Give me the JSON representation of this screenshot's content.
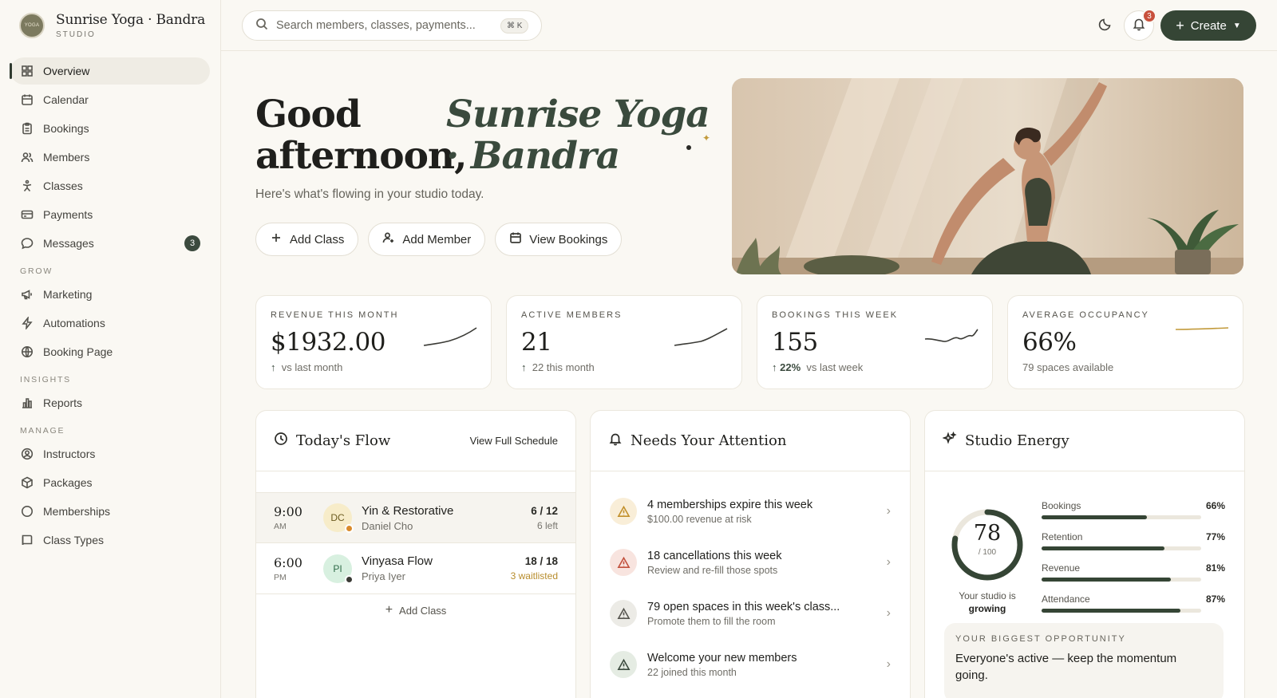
{
  "brand": {
    "name": "Sunrise Yoga · Bandra",
    "sub": "STUDIO",
    "logo_text": "YOGA"
  },
  "sidebar": {
    "items": [
      {
        "label": "Overview",
        "icon": "grid-icon"
      },
      {
        "label": "Calendar",
        "icon": "calendar-icon"
      },
      {
        "label": "Bookings",
        "icon": "clipboard-icon"
      },
      {
        "label": "Members",
        "icon": "users-icon"
      },
      {
        "label": "Classes",
        "icon": "yoga-pose-icon"
      },
      {
        "label": "Payments",
        "icon": "card-icon"
      },
      {
        "label": "Messages",
        "icon": "chat-icon",
        "badge": "3"
      }
    ],
    "grow_label": "GROW",
    "grow": [
      {
        "label": "Marketing",
        "icon": "megaphone-icon"
      },
      {
        "label": "Automations",
        "icon": "bolt-icon"
      },
      {
        "label": "Booking Page",
        "icon": "globe-icon"
      }
    ],
    "insights_label": "INSIGHTS",
    "insights": [
      {
        "label": "Reports",
        "icon": "bar-chart-icon"
      }
    ],
    "manage_label": "MANAGE",
    "manage": [
      {
        "label": "Instructors",
        "icon": "user-circle-icon"
      },
      {
        "label": "Packages",
        "icon": "package-icon"
      },
      {
        "label": "Memberships",
        "icon": "circle-icon"
      },
      {
        "label": "Class Types",
        "icon": "book-icon"
      }
    ]
  },
  "topbar": {
    "search_placeholder": "Search members, classes, payments...",
    "search_kbd": "⌘ K",
    "notifications_count": "3",
    "create_label": "Create"
  },
  "hero": {
    "greeting_line1": "Good",
    "greeting_line2": "afternoon,",
    "studio_line1": "Sunrise Yoga",
    "studio_line2": "· Bandra",
    "subtitle": "Here's what's flowing in your studio today.",
    "actions": [
      "Add Class",
      "Add Member",
      "View Bookings"
    ]
  },
  "stats": [
    {
      "label": "REVENUE THIS MONTH",
      "value": "$1932.00",
      "arrow": "↑",
      "pct": "",
      "sub": "vs last month"
    },
    {
      "label": "ACTIVE MEMBERS",
      "value": "21",
      "arrow": "↑",
      "pct": "",
      "sub": "22 this month"
    },
    {
      "label": "BOOKINGS THIS WEEK",
      "value": "155",
      "arrow": "↑",
      "pct": "22%",
      "sub": "vs last week"
    },
    {
      "label": "AVERAGE OCCUPANCY",
      "value": "66%",
      "arrow": "",
      "pct": "",
      "sub": "79 spaces available"
    }
  ],
  "todays_flow": {
    "title": "Today's Flow",
    "link": "View Full Schedule",
    "classes": [
      {
        "time": "9:00",
        "ampm": "AM",
        "initials": "DC",
        "name": "Yin & Restorative",
        "instructor": "Daniel Cho",
        "capacity": "6 / 12",
        "status": "6 left"
      },
      {
        "time": "6:00",
        "ampm": "PM",
        "initials": "PI",
        "name": "Vinyasa Flow",
        "instructor": "Priya Iyer",
        "capacity": "18 / 18",
        "status": "3 waitlisted"
      }
    ],
    "add_label": "Add Class"
  },
  "attention": {
    "title": "Needs Your Attention",
    "items": [
      {
        "title": "4 memberships expire this week",
        "sub": "$100.00 revenue at risk"
      },
      {
        "title": "18 cancellations this week",
        "sub": "Review and re-fill those spots"
      },
      {
        "title": "79 open spaces in this week's class...",
        "sub": "Promote them to fill the room"
      },
      {
        "title": "Welcome your new members",
        "sub": "22 joined this month"
      }
    ]
  },
  "energy": {
    "title": "Studio Energy",
    "score": "78",
    "score_of": "/ 100",
    "score_value": 78,
    "caption_prefix": "Your studio is",
    "caption_state": "growing",
    "metrics": [
      {
        "label": "Bookings",
        "pct": "66%",
        "value": 66
      },
      {
        "label": "Retention",
        "pct": "77%",
        "value": 77
      },
      {
        "label": "Revenue",
        "pct": "81%",
        "value": 81
      },
      {
        "label": "Attendance",
        "pct": "87%",
        "value": 87
      }
    ],
    "opportunity_label": "YOUR BIGGEST OPPORTUNITY",
    "opportunity_text": "Everyone's active — keep the momentum going."
  }
}
